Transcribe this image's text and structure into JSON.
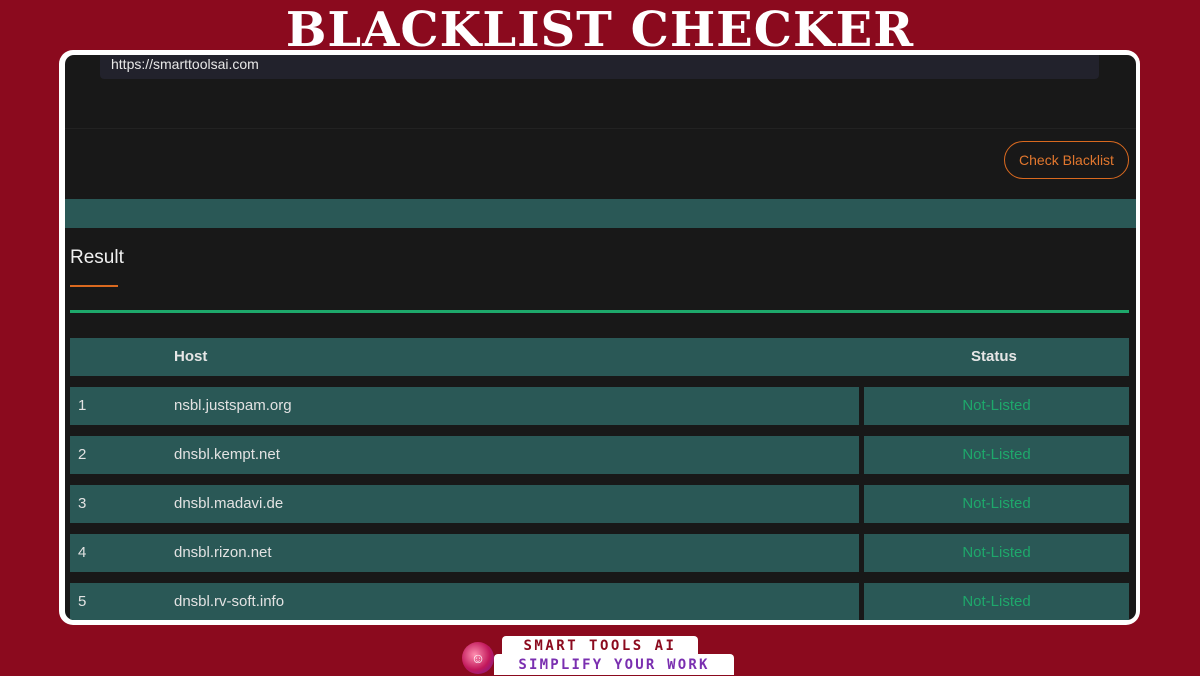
{
  "page_title": "BLACKLIST CHECKER",
  "url_input": {
    "value": "https://smarttoolsai.com"
  },
  "check_button": {
    "label": "Check Blacklist"
  },
  "result": {
    "heading": "Result",
    "columns": {
      "index": "",
      "host": "Host",
      "status": "Status"
    },
    "rows": [
      {
        "index": "1",
        "host": "nsbl.justspam.org",
        "status": "Not-Listed"
      },
      {
        "index": "2",
        "host": "dnsbl.kempt.net",
        "status": "Not-Listed"
      },
      {
        "index": "3",
        "host": "dnsbl.madavi.de",
        "status": "Not-Listed"
      },
      {
        "index": "4",
        "host": "dnsbl.rizon.net",
        "status": "Not-Listed"
      },
      {
        "index": "5",
        "host": "dnsbl.rv-soft.info",
        "status": "Not-Listed"
      }
    ]
  },
  "brand": {
    "line1": "SMART TOOLS AI",
    "line2": "SIMPLIFY YOUR WORK",
    "logo_icon": "robot-logo-icon"
  },
  "colors": {
    "background": "#8b0a1e",
    "panel": "#181818",
    "teal": "#2a5856",
    "accent_orange": "#d9691f",
    "status_green": "#1ea86b"
  }
}
